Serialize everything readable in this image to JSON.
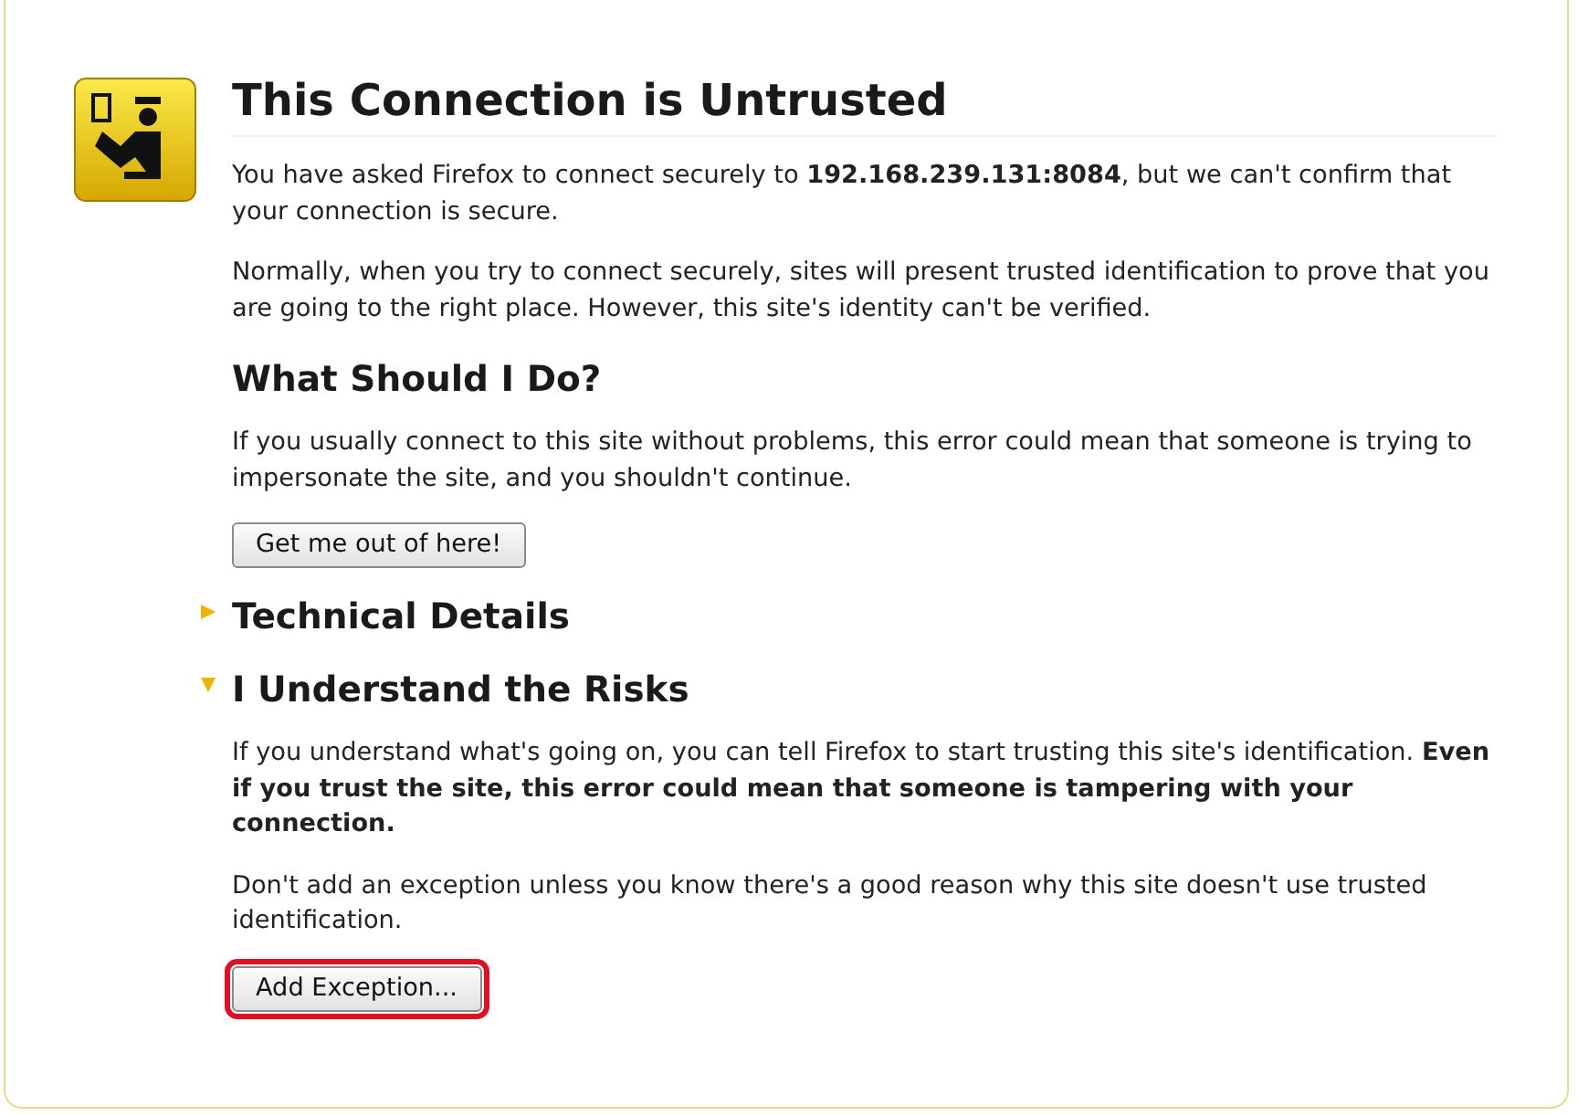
{
  "title": "This Connection is Untrusted",
  "intro": [
    "You have asked Firefox to connect securely to **192.168.239.131:8084**, but we can't confirm that your connection is secure.",
    "Normally, when you try to connect securely, sites will present trusted identification to prove that you are going to the right place. However, this site's identity can't be verified."
  ],
  "sections": [
    {
      "kind": "plain",
      "heading": "What Should I Do?",
      "paragraphs": [
        "If you usually connect to this site without problems, this error could mean that someone is trying to impersonate the site, and you shouldn't continue."
      ],
      "button": {
        "label": "Get me out of here!",
        "highlighted": false
      }
    },
    {
      "kind": "toggle",
      "heading": "Technical Details",
      "expanded": false
    },
    {
      "kind": "toggle",
      "heading": "I Understand the Risks",
      "expanded": true,
      "paragraphs": [
        "If you understand what's going on, you can tell Firefox to start trusting this site's identification. **Even if you trust the site, this error could mean that someone is tampering with your connection.**",
        "Don't add an exception unless you know there's a good reason why this site doesn't use trusted identification."
      ],
      "button": {
        "label": "Add Exception...",
        "highlighted": true
      }
    }
  ]
}
